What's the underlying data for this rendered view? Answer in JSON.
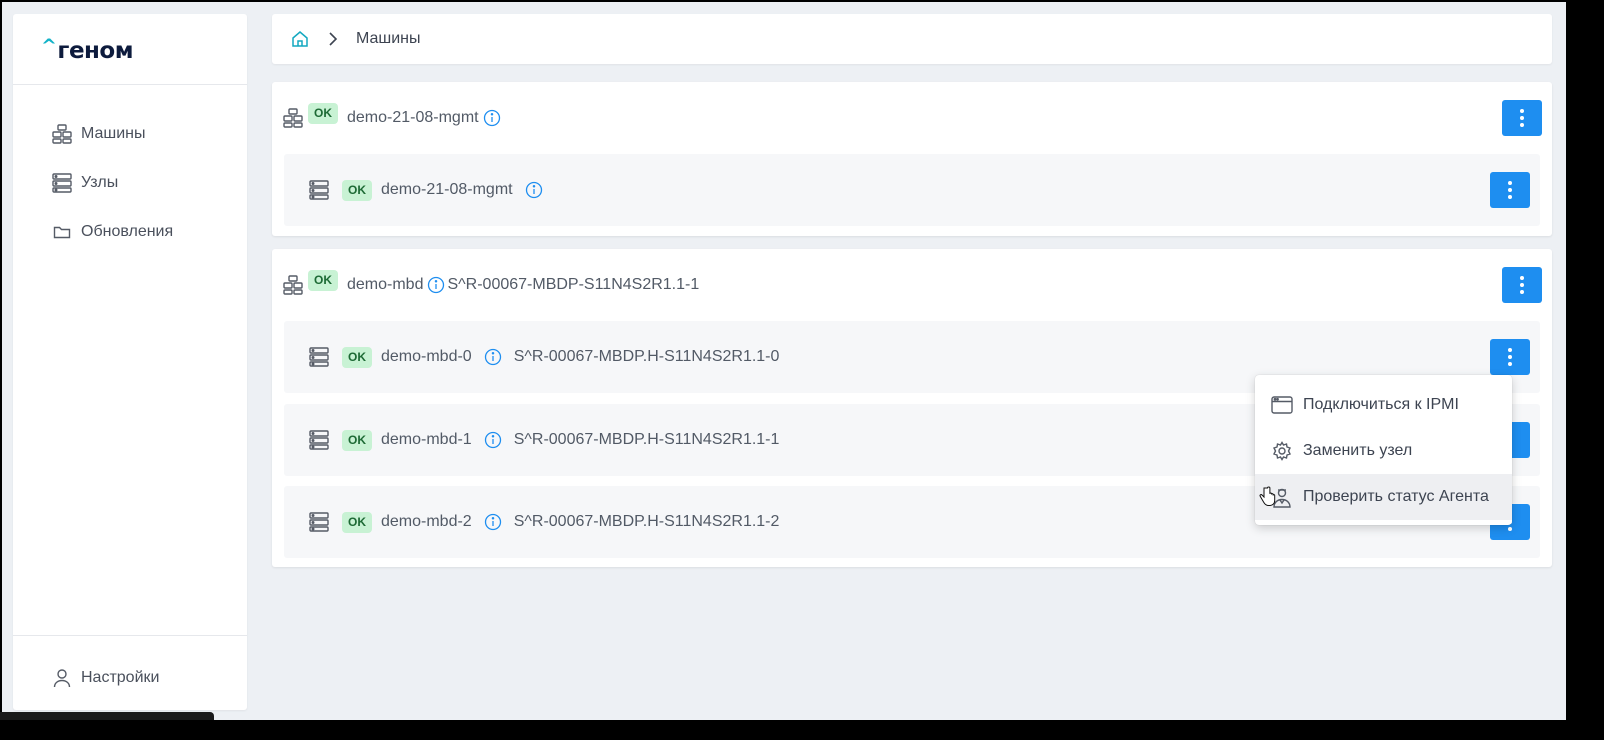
{
  "app": {
    "logo_text": "геном",
    "logo_caret": "^"
  },
  "sidebar": {
    "items": [
      {
        "label": "Машины",
        "icon": "machines-icon"
      },
      {
        "label": "Узлы",
        "icon": "nodes-icon"
      },
      {
        "label": "Обновления",
        "icon": "folder-icon"
      }
    ],
    "settings_label": "Настройки"
  },
  "breadcrumb": {
    "current": "Машины"
  },
  "machines": [
    {
      "name": "demo-21-08-mgmt",
      "status": "OK",
      "serial": "",
      "nodes": [
        {
          "name": "demo-21-08-mgmt",
          "status": "OK",
          "serial": ""
        }
      ]
    },
    {
      "name": "demo-mbd",
      "status": "OK",
      "serial": "S^R-00067-MBDP-S11N4S2R1.1-1",
      "nodes": [
        {
          "name": "demo-mbd-0",
          "status": "OK",
          "serial": "S^R-00067-MBDP.H-S11N4S2R1.1-0"
        },
        {
          "name": "demo-mbd-1",
          "status": "OK",
          "serial": "S^R-00067-MBDP.H-S11N4S2R1.1-1"
        },
        {
          "name": "demo-mbd-2",
          "status": "OK",
          "serial": "S^R-00067-MBDP.H-S11N4S2R1.1-2"
        }
      ]
    }
  ],
  "context_menu": {
    "items": [
      {
        "label": "Подключиться к IPMI",
        "icon": "browser-window-icon"
      },
      {
        "label": "Заменить узел",
        "icon": "gear-icon"
      },
      {
        "label": "Проверить статус Агента",
        "icon": "agent-icon"
      }
    ]
  },
  "colors": {
    "accent": "#1e8ef0",
    "ok_bg": "#c8f2d4",
    "ok_text": "#1d6a35",
    "logo_caret": "#13b3c8"
  }
}
